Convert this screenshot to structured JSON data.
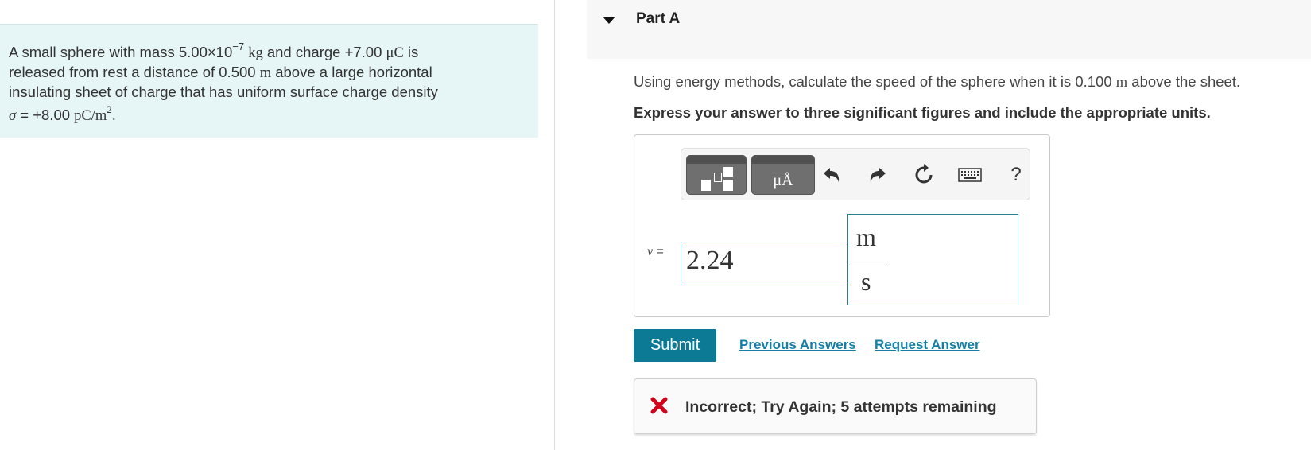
{
  "problem": {
    "l1_pre": "A small sphere with mass 5.00",
    "l1_times": "×",
    "l1_ten": "10",
    "l1_exp": "−7",
    "l1_kg": "kg",
    "l1_mid": " and charge +7.00 ",
    "l1_uC": "μC",
    "l1_post": " is",
    "l2_pre": "released from rest a distance of 0.500 ",
    "l2_m": "m",
    "l2_post": " above a large horizontal",
    "l3": "insulating sheet of charge that has uniform surface charge density",
    "l4_sigma": "σ",
    "l4_eq": " = +8.00 ",
    "l4_unit": "pC/m",
    "l4_exp": "2",
    "l4_end": "."
  },
  "part": {
    "title": "Part A"
  },
  "question": {
    "pre": "Using energy methods, calculate the speed of the sphere when it is 0.100 ",
    "m": "m",
    "post": " above the sheet."
  },
  "instruction": "Express your answer to three significant figures and include the appropriate units.",
  "toolbar": {
    "units_glyph": "μÅ",
    "help": "?",
    "icons": [
      "templates-icon",
      "units-icon",
      "undo-icon",
      "redo-icon",
      "reset-icon",
      "keyboard-icon",
      "help-icon"
    ]
  },
  "answer": {
    "variable": "v",
    "equals": " =",
    "value": "2.24",
    "unit_numerator": "m",
    "unit_denominator": "s"
  },
  "actions": {
    "submit": "Submit",
    "previous_answers": "Previous Answers",
    "request_answer": "Request Answer"
  },
  "feedback": {
    "text": "Incorrect; Try Again; 5 attempts remaining"
  },
  "colors": {
    "accent": "#0d7a95",
    "link": "#1580a7",
    "problem_bg": "#e6f5f5",
    "error_x": "#d0021b",
    "input_border": "#2a7f8f"
  }
}
